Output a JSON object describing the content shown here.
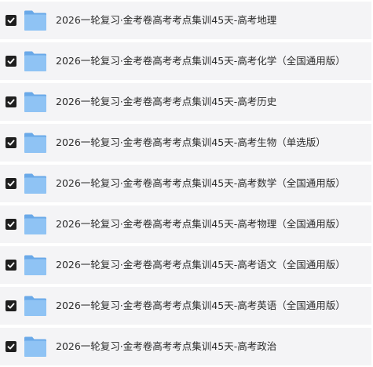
{
  "files": [
    {
      "name": "2026一轮复习·金考卷高考考点集训45天-高考地理",
      "checked": true,
      "icon": "folder-icon"
    },
    {
      "name": "2026一轮复习·金考卷高考考点集训45天-高考化学（全国通用版）",
      "checked": true,
      "icon": "folder-icon"
    },
    {
      "name": "2026一轮复习·金考卷高考考点集训45天-高考历史",
      "checked": true,
      "icon": "folder-icon"
    },
    {
      "name": "2026一轮复习·金考卷高考考点集训45天-高考生物（单选版）",
      "checked": true,
      "icon": "folder-icon"
    },
    {
      "name": "2026一轮复习·金考卷高考考点集训45天-高考数学（全国通用版）",
      "checked": true,
      "icon": "folder-icon"
    },
    {
      "name": "2026一轮复习·金考卷高考考点集训45天-高考物理（全国通用版）",
      "checked": true,
      "icon": "folder-icon"
    },
    {
      "name": "2026一轮复习·金考卷高考考点集训45天-高考语文（全国通用版）",
      "checked": true,
      "icon": "folder-icon"
    },
    {
      "name": "2026一轮复习·金考卷高考考点集训45天-高考英语（全国通用版）",
      "checked": true,
      "icon": "folder-icon"
    },
    {
      "name": "2026一轮复习·金考卷高考考点集训45天-高考政治",
      "checked": true,
      "icon": "folder-icon"
    }
  ],
  "colors": {
    "row_background": "#f4f4f6",
    "checkbox": "#1f1f1f",
    "folder_front": "#8fc3f4",
    "folder_back": "#6aa9e8"
  }
}
